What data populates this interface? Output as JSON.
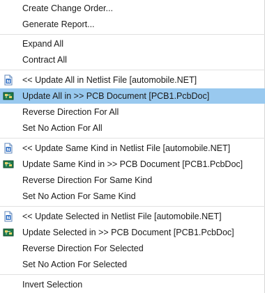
{
  "menu": {
    "items": [
      {
        "label": "Create Change Order...",
        "icon": null,
        "highlighted": false
      },
      {
        "label": "Generate Report...",
        "icon": null,
        "highlighted": false
      },
      {
        "label": "Expand All",
        "icon": null,
        "highlighted": false
      },
      {
        "label": "Contract All",
        "icon": null,
        "highlighted": false
      },
      {
        "label": "<< Update All in Netlist File [automobile.NET]",
        "icon": "netlist-file-icon",
        "highlighted": false
      },
      {
        "label": "Update All in >> PCB Document [PCB1.PcbDoc]",
        "icon": "pcb-document-icon",
        "highlighted": true
      },
      {
        "label": "Reverse Direction For All",
        "icon": null,
        "highlighted": false
      },
      {
        "label": "Set No Action For All",
        "icon": null,
        "highlighted": false
      },
      {
        "label": "<< Update Same Kind in Netlist File [automobile.NET]",
        "icon": "netlist-file-icon",
        "highlighted": false
      },
      {
        "label": "Update Same Kind in >> PCB Document [PCB1.PcbDoc]",
        "icon": "pcb-document-icon",
        "highlighted": false
      },
      {
        "label": "Reverse Direction For Same Kind",
        "icon": null,
        "highlighted": false
      },
      {
        "label": "Set No Action For Same Kind",
        "icon": null,
        "highlighted": false
      },
      {
        "label": "<< Update Selected in Netlist File [automobile.NET]",
        "icon": "netlist-file-icon",
        "highlighted": false
      },
      {
        "label": "Update Selected in >> PCB Document [PCB1.PcbDoc]",
        "icon": "pcb-document-icon",
        "highlighted": false
      },
      {
        "label": "Reverse Direction For Selected",
        "icon": null,
        "highlighted": false
      },
      {
        "label": "Set No Action For Selected",
        "icon": null,
        "highlighted": false
      },
      {
        "label": "Invert Selection",
        "icon": null,
        "highlighted": false
      }
    ]
  },
  "colors": {
    "highlight": "#99c9ef",
    "separator": "#e1e1e1",
    "netlist_icon_blue": "#2b6cc4",
    "pcb_icon_green": "#1f7a4a"
  }
}
